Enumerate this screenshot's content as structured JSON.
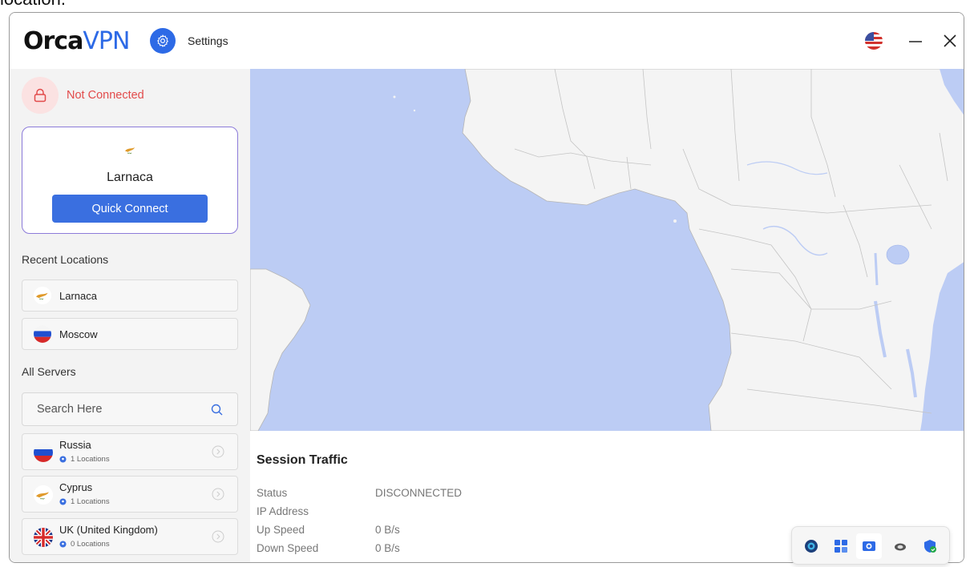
{
  "background_caption": "location.",
  "window": {
    "logo_orca": "Orca",
    "logo_vpn": "VPN",
    "settings_label": "Settings"
  },
  "status": {
    "text": "Not Connected",
    "color": "#e24b4b"
  },
  "quick_connect": {
    "flag": "cyprus-flag-icon",
    "city": "Larnaca",
    "button_label": "Quick Connect"
  },
  "recent": {
    "title": "Recent Locations",
    "items": [
      {
        "name": "Larnaca",
        "flag": "cyprus-flag-icon"
      },
      {
        "name": "Moscow",
        "flag": "russia-flag-icon"
      }
    ]
  },
  "servers": {
    "title": "All Servers",
    "search_placeholder": "Search Here",
    "items": [
      {
        "name": "Russia",
        "count": "1 Locations",
        "flag": "russia-flag-icon"
      },
      {
        "name": "Cyprus",
        "count": "1 Locations",
        "flag": "cyprus-flag-icon"
      },
      {
        "name": "UK (United Kingdom)",
        "count": "0 Locations",
        "flag": "uk-flag-icon"
      }
    ]
  },
  "session": {
    "title": "Session Traffic",
    "rows": [
      {
        "label": "Status",
        "value": "DISCONNECTED"
      },
      {
        "label": "IP Address",
        "value": ""
      },
      {
        "label": "Up Speed",
        "value": "0 B/s"
      },
      {
        "label": "Down Speed",
        "value": "0 B/s"
      }
    ]
  },
  "colors": {
    "accent": "#2d6ae6",
    "map_water": "#bcccf4",
    "map_land": "#f4f4f4",
    "card_border": "#8c7bd9"
  },
  "tray_icons": [
    "orca-tray-icon",
    "widgets-tray-icon",
    "camera-tray-icon",
    "cloud-tray-icon",
    "security-tray-icon"
  ]
}
